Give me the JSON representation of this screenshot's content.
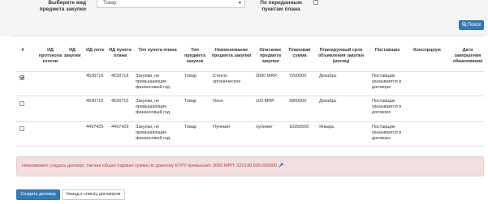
{
  "filters": {
    "subject_type_label": "Выберите вид предмета закупки",
    "subject_type_value": "Товар",
    "by_plan_items_label": "По переданным пунктам плана",
    "search_button": "Поиск"
  },
  "table": {
    "headers": [
      "#",
      "ИД протокола итогов",
      "ИД закупки",
      "ИД лота",
      "ИД пункта плана",
      "Тип пункта плана",
      "Тип предмета закупок",
      "Наименование предмета закупки",
      "Описание предмета закупки",
      "Плановая сумма",
      "Планируемый срок объявления закупки (месяц)",
      "Поставщик",
      "Консорциум",
      "Дата завершения обжалования"
    ],
    "rows": [
      {
        "checked": true,
        "protocol_id": "",
        "purchase_id": "",
        "lot_id": "4530718",
        "plan_item_id": "4530718",
        "plan_item_type": "Закупки, не превышающие финансовый год",
        "subject_type": "Товар",
        "subject_name": "Стекло органическое",
        "subject_description": "3000 МRP",
        "planned_sum": "7200000",
        "planned_month": "Декабрь",
        "supplier": "Поставщик указывается в договоре",
        "consortium": "",
        "appeal_end_date": ""
      },
      {
        "checked": false,
        "protocol_id": "",
        "purchase_id": "",
        "lot_id": "4530715",
        "plan_item_id": "4530715",
        "plan_item_type": "Закупки, не превышающие финансовый год",
        "subject_type": "Товар",
        "subject_name": "Окно",
        "subject_description": "100 МRP",
        "planned_sum": "2800000",
        "planned_month": "Декабрь",
        "supplier": "Поставщик указывается в договоре",
        "consortium": "",
        "appeal_end_date": ""
      },
      {
        "checked": false,
        "protocol_id": "",
        "purchase_id": "",
        "lot_id": "4497429",
        "plan_item_id": "4497429",
        "plan_item_type": "Закупки, не превышающие финансовый год",
        "subject_type": "Товар",
        "subject_name": "Пулемет",
        "subject_description": "пулемет",
        "planned_sum": "10250000",
        "planned_month": "Январь",
        "supplier": "Поставщик указывается в договоре",
        "consortium": "",
        "appeal_end_date": ""
      }
    ]
  },
  "alert": {
    "text": "Невозможно создать договор, так как общая годовая сумма по данному КТРУ превышает 3000 МРП: 222130.530.000000"
  },
  "actions": {
    "create_contract": "Создать договор",
    "back_to_list": "Назад к списку договоров"
  },
  "colors": {
    "primary": "#337ab7",
    "alert_background": "#f2dede",
    "alert_text": "#a94442"
  }
}
